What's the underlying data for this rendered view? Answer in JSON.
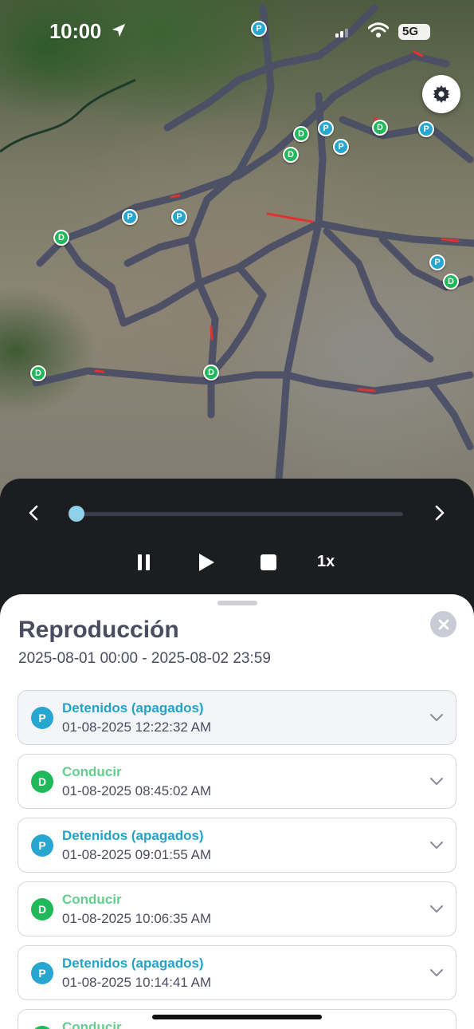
{
  "status_bar": {
    "time": "10:00",
    "battery": "5G"
  },
  "map": {
    "markers": [
      {
        "type": "P",
        "label": "P"
      },
      {
        "type": "P",
        "label": "P"
      },
      {
        "type": "P",
        "label": "P"
      },
      {
        "type": "D",
        "label": "D"
      },
      {
        "type": "D",
        "label": "D"
      },
      {
        "type": "D",
        "label": "D"
      },
      {
        "type": "P",
        "label": "P"
      },
      {
        "type": "P",
        "label": "P"
      },
      {
        "type": "P",
        "label": "P"
      },
      {
        "type": "D",
        "label": "D"
      },
      {
        "type": "P",
        "label": "P"
      },
      {
        "type": "D",
        "label": "D"
      },
      {
        "type": "D",
        "label": "D"
      },
      {
        "type": "D",
        "label": "D"
      }
    ],
    "colors": {
      "parked": "#27a6cf",
      "driving": "#1fb85a",
      "route": "#4b4f66",
      "speeding": "#e0322e"
    }
  },
  "player": {
    "speed_label": "1x",
    "progress": 0.0
  },
  "sheet": {
    "title": "Reproducción",
    "date_range": "2025-08-01 00:00 - 2025-08-02 23:59",
    "items": [
      {
        "badge": "P",
        "title": "Detenidos (apagados)",
        "time": "01-08-2025 12:22:32 AM"
      },
      {
        "badge": "D",
        "title": "Conducir",
        "time": "01-08-2025 08:45:02 AM"
      },
      {
        "badge": "P",
        "title": "Detenidos (apagados)",
        "time": "01-08-2025 09:01:55 AM"
      },
      {
        "badge": "D",
        "title": "Conducir",
        "time": "01-08-2025 10:06:35 AM"
      },
      {
        "badge": "P",
        "title": "Detenidos (apagados)",
        "time": "01-08-2025 10:14:41 AM"
      },
      {
        "badge": "D",
        "title": "Conducir",
        "time": ""
      }
    ]
  }
}
